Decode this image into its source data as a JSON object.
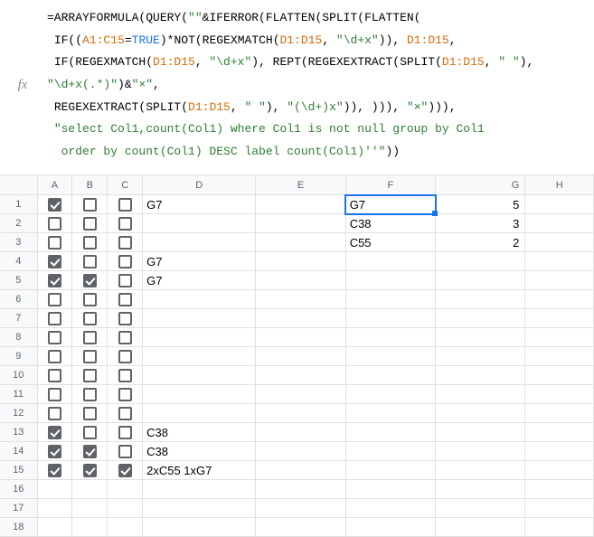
{
  "formula": {
    "line1_prefix": "=ARRAYFORMULA(QUERY(",
    "line1_str": "\"\"",
    "line1_amp": "&IFERROR(FLATTEN(SPLIT(FLATTEN(",
    "line2_if": " IF((",
    "line2_ref1": "A1:C15",
    "line2_eq": "=",
    "line2_true": "TRUE",
    "line2_mid": ")*NOT(REGEXMATCH(",
    "line2_ref2": "D1:D15",
    "line2_c1": ", ",
    "line2_str1": "\"\\d+x\"",
    "line2_tail": ")), ",
    "line2_ref3": "D1:D15",
    "line2_tail2": ",",
    "line3_if": " IF(REGEXMATCH(",
    "line3_ref1": "D1:D15",
    "line3_c1": ", ",
    "line3_str1": "\"\\d+x\"",
    "line3_mid": "), REPT(REGEXEXTRACT(SPLIT(",
    "line3_ref2": "D1:D15",
    "line3_c2": ", ",
    "line3_str2": "\" \"",
    "line3_c3": "), ",
    "line3_str3": "\"\\d+x(.*)\"",
    "line3_c4": ")&",
    "line3_str4": "\"×\"",
    "line3_tail": ",",
    "line4_pre": " REGEXEXTRACT(SPLIT(",
    "line4_ref1": "D1:D15",
    "line4_c1": ", ",
    "line4_str1": "\" \"",
    "line4_c2": "), ",
    "line4_str2": "\"(\\d+)x\"",
    "line4_c3": ")), ))), ",
    "line4_str3": "\"×\"",
    "line4_tail": "))),",
    "line5_str": " \"select Col1,count(Col1) where Col1 is not null group by Col1",
    "line6_str": "  order by count(Col1) DESC label count(Col1)''\"",
    "line6_tail": "))"
  },
  "headers": [
    "A",
    "B",
    "C",
    "D",
    "E",
    "F",
    "G",
    "H"
  ],
  "row_headers": [
    "1",
    "2",
    "3",
    "4",
    "5",
    "6",
    "7",
    "8",
    "9",
    "10",
    "11",
    "12",
    "13",
    "14",
    "15",
    "16",
    "17",
    "18"
  ],
  "rows": [
    {
      "a": true,
      "b": false,
      "c": false,
      "d": "G7",
      "f": "G7",
      "g": "5"
    },
    {
      "a": false,
      "b": false,
      "c": false,
      "d": "",
      "f": "C38",
      "g": "3"
    },
    {
      "a": false,
      "b": false,
      "c": false,
      "d": "",
      "f": "C55",
      "g": "2"
    },
    {
      "a": true,
      "b": false,
      "c": false,
      "d": "G7",
      "f": "",
      "g": ""
    },
    {
      "a": true,
      "b": true,
      "c": false,
      "d": "G7",
      "f": "",
      "g": ""
    },
    {
      "a": false,
      "b": false,
      "c": false,
      "d": "",
      "f": "",
      "g": ""
    },
    {
      "a": false,
      "b": false,
      "c": false,
      "d": "",
      "f": "",
      "g": ""
    },
    {
      "a": false,
      "b": false,
      "c": false,
      "d": "",
      "f": "",
      "g": ""
    },
    {
      "a": false,
      "b": false,
      "c": false,
      "d": "",
      "f": "",
      "g": ""
    },
    {
      "a": false,
      "b": false,
      "c": false,
      "d": "",
      "f": "",
      "g": ""
    },
    {
      "a": false,
      "b": false,
      "c": false,
      "d": "",
      "f": "",
      "g": ""
    },
    {
      "a": false,
      "b": false,
      "c": false,
      "d": "",
      "f": "",
      "g": ""
    },
    {
      "a": true,
      "b": false,
      "c": false,
      "d": "C38",
      "f": "",
      "g": ""
    },
    {
      "a": true,
      "b": true,
      "c": false,
      "d": "C38",
      "f": "",
      "g": ""
    },
    {
      "a": true,
      "b": true,
      "c": true,
      "d": "2xC55 1xG7",
      "f": "",
      "g": ""
    }
  ],
  "fx_label": "fx"
}
